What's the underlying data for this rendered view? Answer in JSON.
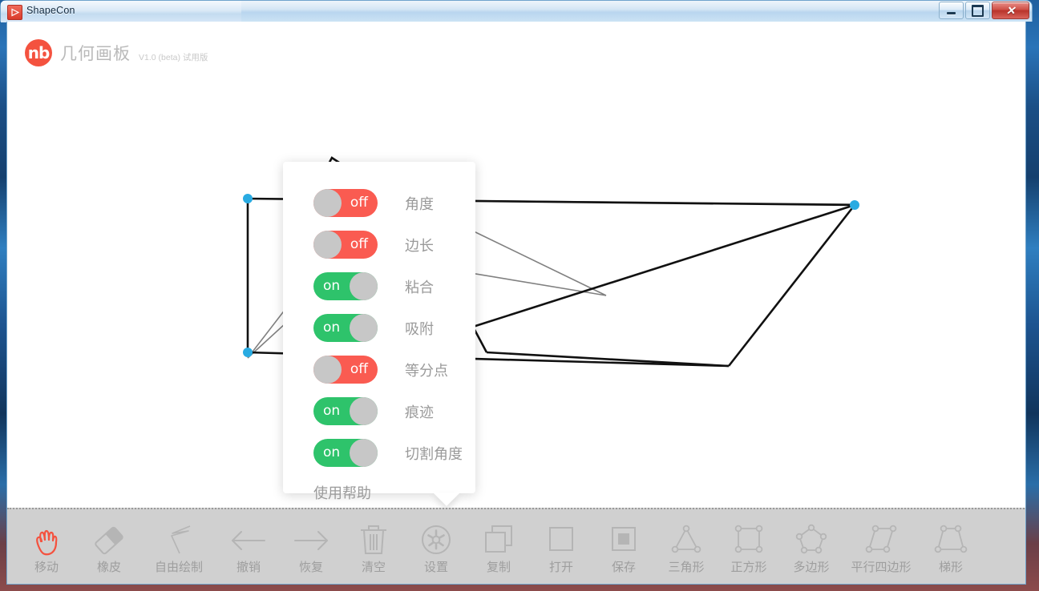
{
  "window": {
    "title": "ShapeCon",
    "app_icon": "triangle-play-icon",
    "controls": [
      {
        "name": "minimize",
        "glyph": "minimize-icon"
      },
      {
        "name": "maximize",
        "glyph": "maximize-icon"
      },
      {
        "name": "close",
        "glyph": "close-icon",
        "color": "#b8332b"
      }
    ]
  },
  "brand": {
    "logo_text": "nb",
    "logo_color": "#f4523f",
    "name": "几何画板",
    "version": "V1.0 (beta) 试用版"
  },
  "settings_popup": {
    "options": [
      {
        "state": "off",
        "state_label": "off",
        "label": "角度"
      },
      {
        "state": "off",
        "state_label": "off",
        "label": "边长"
      },
      {
        "state": "on",
        "state_label": "on",
        "label": "粘合"
      },
      {
        "state": "on",
        "state_label": "on",
        "label": "吸附"
      },
      {
        "state": "off",
        "state_label": "off",
        "label": "等分点"
      },
      {
        "state": "on",
        "state_label": "on",
        "label": "痕迹"
      },
      {
        "state": "on",
        "state_label": "on",
        "label": "切割角度"
      }
    ],
    "help_label": "使用帮助",
    "on_color": "#2ec36b",
    "off_color": "#fa5b51",
    "knob_color": "#c7c7c7"
  },
  "toolbar": {
    "items": [
      {
        "label": "移动",
        "icon": "hand-icon",
        "active": true
      },
      {
        "label": "橡皮",
        "icon": "eraser-icon",
        "active": false
      },
      {
        "label": "自由绘制",
        "icon": "freehand-pen-icon",
        "active": false
      },
      {
        "label": "撤销",
        "icon": "arrow-left-icon",
        "active": false
      },
      {
        "label": "恢复",
        "icon": "arrow-right-icon",
        "active": false
      },
      {
        "label": "清空",
        "icon": "trash-icon",
        "active": false
      },
      {
        "label": "设置",
        "icon": "gear-icon",
        "active": false
      },
      {
        "label": "复制",
        "icon": "copy-icon",
        "active": false
      },
      {
        "label": "打开",
        "icon": "open-square-icon",
        "active": false
      },
      {
        "label": "保存",
        "icon": "save-filled-icon",
        "active": false
      },
      {
        "label": "三角形",
        "icon": "triangle-shape-icon",
        "active": false
      },
      {
        "label": "正方形",
        "icon": "square-shape-icon",
        "active": false
      },
      {
        "label": "多边形",
        "icon": "pentagon-shape-icon",
        "active": false
      },
      {
        "label": "平行四边形",
        "icon": "parallelogram-shape-icon",
        "active": false
      },
      {
        "label": "梯形",
        "icon": "trapezoid-shape-icon",
        "active": false
      }
    ],
    "active_color": "#f4523f",
    "icon_color": "#b0b0b0",
    "label_color": "#9e9e9e",
    "background": "#d0d0d0"
  },
  "canvas": {
    "vertex_color": "#29abe2",
    "stroke_color": "#111111",
    "trace_color": "#808080"
  }
}
